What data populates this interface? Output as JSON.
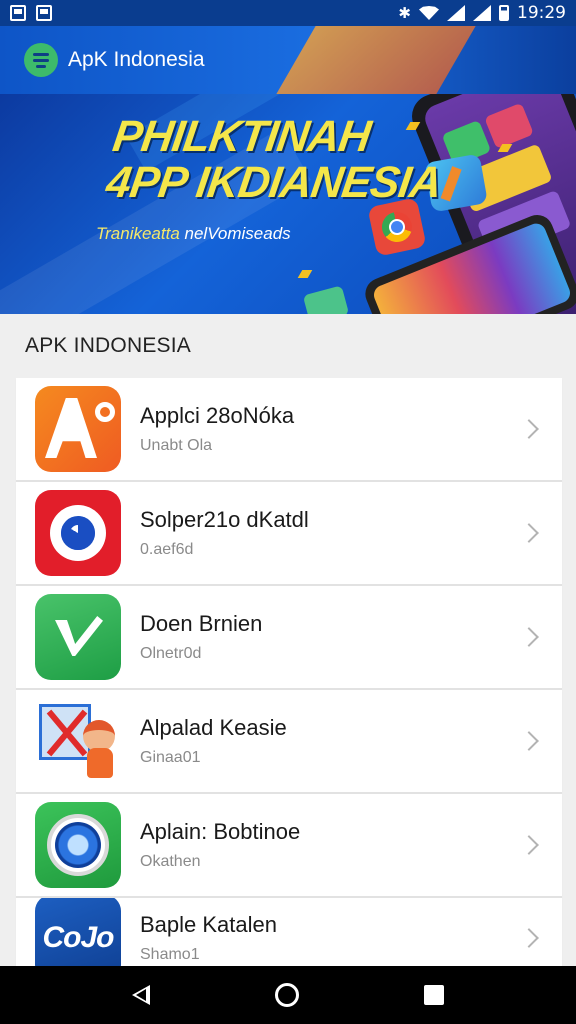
{
  "status_bar": {
    "time": "19:29"
  },
  "app_bar": {
    "title": "ApK Indonesia",
    "menu_icon": "list-icon"
  },
  "banner": {
    "title_line1": "PHILKTINAH",
    "title_line2": "4PP IKDIANESIA",
    "subtitle_part1": "Tranikeatta",
    "subtitle_part2": " nelVomiseads"
  },
  "section": {
    "title": "APK INDONESIA"
  },
  "apps": [
    {
      "name": "Applci 28oNóka",
      "sub": "Unabt Ola",
      "icon": "letter-a-icon"
    },
    {
      "name": "Solper21o dKatdl",
      "sub": "0.aef6d",
      "icon": "c-logo-icon"
    },
    {
      "name": "Doen Brnien",
      "sub": "Olnetr0d",
      "icon": "checkmark-icon"
    },
    {
      "name": "Alpalad Keasie",
      "sub": "Ginaa01",
      "icon": "kid-cross-icon"
    },
    {
      "name": "Aplain: Bobtinoe",
      "sub": "Okathen",
      "icon": "lens-icon"
    },
    {
      "name": "Baple Katalen",
      "sub": "Shamo1",
      "icon": "cojo-icon",
      "icon_text": "CoJo"
    }
  ],
  "colors": {
    "status_bar": "#0a3d8f",
    "app_bar": "#1a6de0",
    "accent_green": "#3dbb6b",
    "banner_text": "#f4e64a"
  }
}
